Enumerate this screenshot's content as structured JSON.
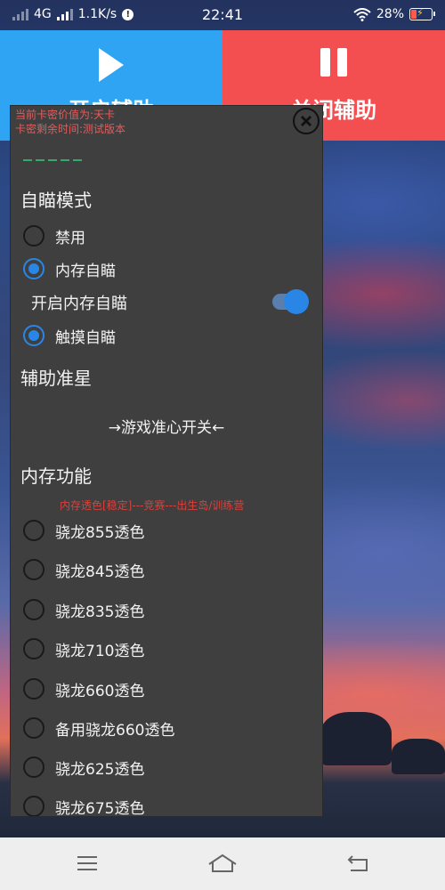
{
  "status_bar": {
    "network": "4G",
    "speed": "1.1K/s",
    "time": "22:41",
    "battery": "28%"
  },
  "actions": {
    "start_label": "开启辅助",
    "stop_label": "关闭辅助"
  },
  "panel": {
    "card_value": "当前卡密价值为:天卡",
    "card_remaining": "卡密剩余时间:测试版本",
    "aim_section": {
      "title": "自瞄模式",
      "options": [
        {
          "label": "禁用",
          "selected": false
        },
        {
          "label": "内存自瞄",
          "selected": true
        },
        {
          "label": "触摸自瞄",
          "selected": true
        }
      ],
      "toggle_label": "开启内存自瞄",
      "toggle_on": true
    },
    "crosshair_section": {
      "title": "辅助准星",
      "switch_text": "→游戏准心开关←"
    },
    "memory_section": {
      "title": "内存功能",
      "note": "内存透色[稳定]---竞赛---出生岛/训练营",
      "options": [
        {
          "label": "骁龙855透色",
          "selected": false
        },
        {
          "label": "骁龙845透色",
          "selected": false
        },
        {
          "label": "骁龙835透色",
          "selected": false
        },
        {
          "label": "骁龙710透色",
          "selected": false
        },
        {
          "label": "骁龙660透色",
          "selected": false
        },
        {
          "label": "备用骁龙660透色",
          "selected": false
        },
        {
          "label": "骁龙625透色",
          "selected": false
        },
        {
          "label": "骁龙675透色",
          "selected": false
        }
      ]
    }
  },
  "colors": {
    "start_button": "#2fa4f3",
    "stop_button": "#f34f50",
    "panel_bg": "#3f3f3f",
    "accent": "#2a86e6",
    "warning_text": "#e55b5b"
  },
  "icons": {
    "start": "play-icon",
    "stop": "pause-icon",
    "close": "close-icon",
    "wifi": "wifi-icon",
    "battery": "battery-icon"
  }
}
